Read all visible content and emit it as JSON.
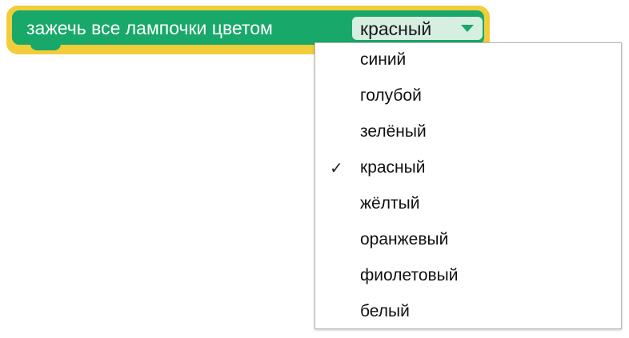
{
  "block": {
    "label": "зажечь все лампочки цветом",
    "field_value": "красный",
    "colors": {
      "block": "#18a86a",
      "outline": "#f2cd3b",
      "field": "#d6efe1"
    }
  },
  "dropdown": {
    "selected": "красный",
    "check_glyph": "✓",
    "items": [
      {
        "label": "синий",
        "checked": false
      },
      {
        "label": "голубой",
        "checked": false
      },
      {
        "label": "зелёный",
        "checked": false
      },
      {
        "label": "красный",
        "checked": true
      },
      {
        "label": "жёлтый",
        "checked": false
      },
      {
        "label": "оранжевый",
        "checked": false
      },
      {
        "label": "фиолетовый",
        "checked": false
      },
      {
        "label": "белый",
        "checked": false
      }
    ]
  }
}
